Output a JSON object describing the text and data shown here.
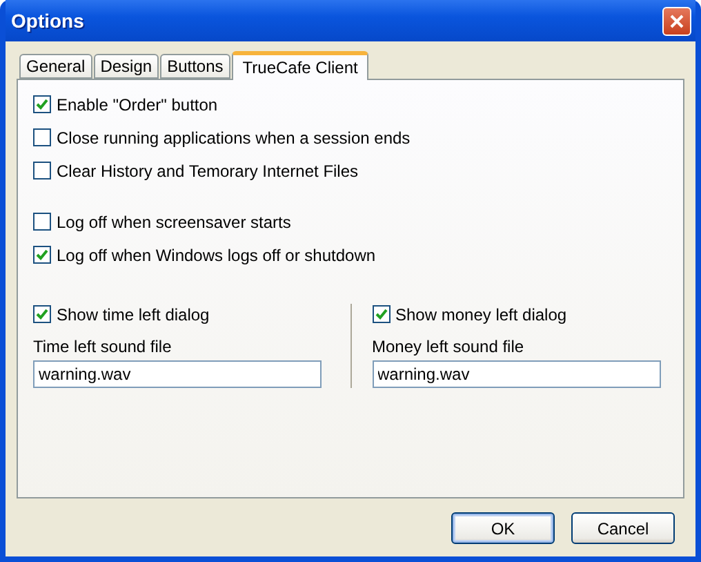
{
  "window": {
    "title": "Options"
  },
  "tabs": [
    {
      "label": "General",
      "selected": false
    },
    {
      "label": "Design",
      "selected": false
    },
    {
      "label": "Buttons",
      "selected": false
    },
    {
      "label": "TrueCafe Client",
      "selected": true
    }
  ],
  "option_groups": [
    [
      {
        "label": "Enable \"Order\" button",
        "checked": true
      },
      {
        "label": "Close running applications when a session ends",
        "checked": false
      },
      {
        "label": "Clear History and Temorary Internet Files",
        "checked": false
      }
    ],
    [
      {
        "label": "Log off when screensaver starts",
        "checked": false
      },
      {
        "label": "Log off when Windows logs off or shutdown",
        "checked": true
      }
    ]
  ],
  "columns": [
    {
      "checkbox": {
        "label": "Show time left dialog",
        "checked": true
      },
      "field_label": "Time left sound file",
      "value": "warning.wav"
    },
    {
      "checkbox": {
        "label": "Show money left dialog",
        "checked": true
      },
      "field_label": "Money left sound file",
      "value": "warning.wav"
    }
  ],
  "buttons": [
    {
      "label": "OK",
      "default": true
    },
    {
      "label": "Cancel",
      "default": false
    }
  ]
}
